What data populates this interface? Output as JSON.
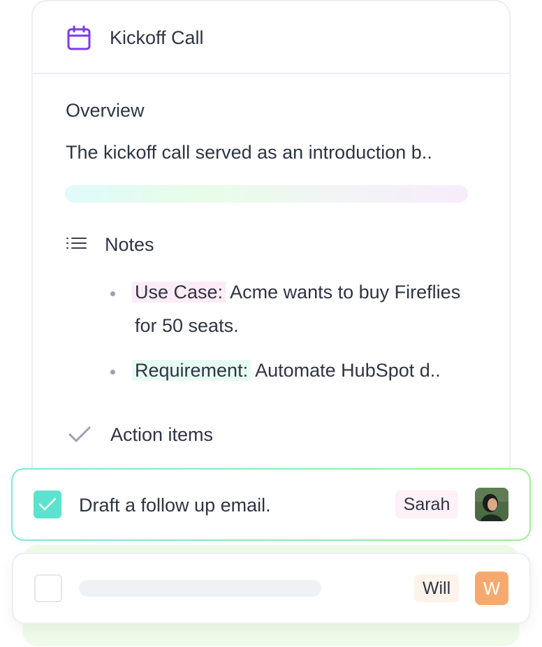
{
  "card": {
    "title": "Kickoff Call",
    "title_icon": "calendar-icon"
  },
  "overview": {
    "title": "Overview",
    "text": "The kickoff call served as an introduction b.."
  },
  "notes": {
    "title": "Notes",
    "icon": "list-icon",
    "items": [
      {
        "label": "Use Case:",
        "text": " Acme wants to buy Fireflies for 50 seats.",
        "highlight": "#fcecf5"
      },
      {
        "label": "Requirement:",
        "text": " Automate HubSpot d..",
        "highlight": "#e8fbf3"
      }
    ]
  },
  "action_items": {
    "title": "Action items",
    "icon": "checkmark-icon",
    "rows": [
      {
        "text": "Draft a follow up email.",
        "checked": true,
        "assignee": "Sarah",
        "avatar": "photo"
      },
      {
        "text": "",
        "checked": false,
        "assignee": "Will",
        "avatar_initial": "W"
      }
    ]
  },
  "colors": {
    "accent_purple": "#7c3aed",
    "check_teal": "#5ce3cf",
    "row_border_gradient": [
      "#7fe7df",
      "#9ef08c"
    ],
    "tag_pink": "#fdf0f7",
    "tag_peach": "#fdf3ea",
    "avatar_orange": "#f5a96f"
  }
}
